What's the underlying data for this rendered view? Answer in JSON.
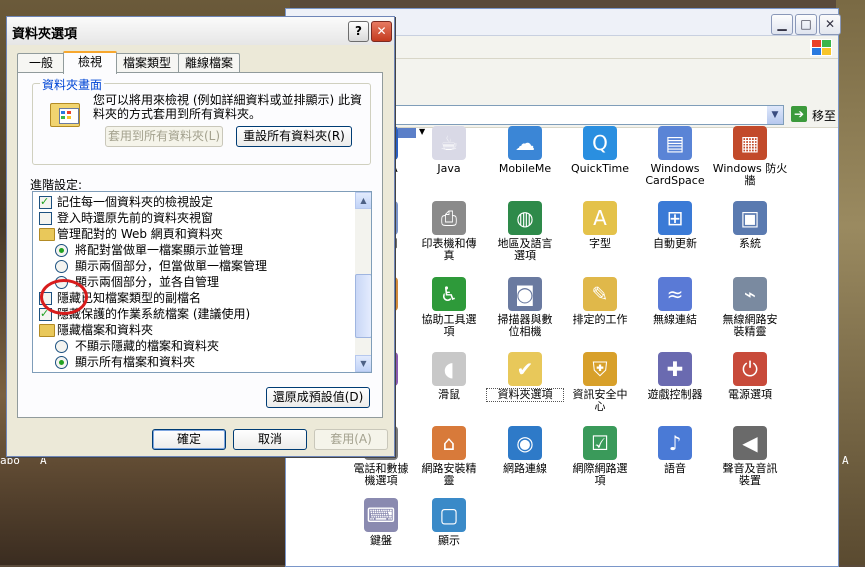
{
  "dialog": {
    "title": "資料夾選項",
    "help": "?",
    "close": "✕",
    "tabs": [
      "一般",
      "檢視",
      "檔案類型",
      "離線檔案"
    ],
    "group": {
      "label": "資料夾畫面",
      "description": "您可以將用來檢視 (例如詳細資料或並排顯示) 此資料夾的方式套用到所有資料夾。",
      "apply_all": "套用到所有資料夾(L)",
      "reset_all": "重設所有資料夾(R)"
    },
    "advanced_label": "進階設定:",
    "advanced_items": [
      {
        "kind": "checkbox",
        "checked": true,
        "text": "記住每一個資料夾的檢視設定"
      },
      {
        "kind": "checkbox",
        "checked": false,
        "text": "登入時還原先前的資料夾視窗"
      },
      {
        "kind": "folder",
        "text": "管理配對的 Web 網頁和資料夾"
      },
      {
        "kind": "radio",
        "checked": true,
        "text": "將配對當做單一檔案顯示並管理"
      },
      {
        "kind": "radio",
        "checked": false,
        "text": "顯示兩個部分，但當做單一檔案管理"
      },
      {
        "kind": "radio",
        "checked": false,
        "text": "顯示兩個部分，並各自管理"
      },
      {
        "kind": "checkbox",
        "checked": false,
        "text": "隱藏已知檔案類型的副檔名"
      },
      {
        "kind": "checkbox",
        "checked": true,
        "text": "隱藏保護的作業系統檔案 (建議使用)"
      },
      {
        "kind": "folder",
        "text": "隱藏檔案和資料夾"
      },
      {
        "kind": "radio",
        "checked": false,
        "text": "不顯示隱藏的檔案和資料夾"
      },
      {
        "kind": "radio",
        "checked": true,
        "text": "顯示所有檔案和資料夾"
      }
    ],
    "restore_defaults": "還原成預設值(D)",
    "ok": "確定",
    "cancel": "取消",
    "apply": "套用(A)"
  },
  "control_panel": {
    "go_label": "移至",
    "icons": [
      {
        "label": ") GMA\nver",
        "icon": "monitor-icon",
        "color": "#2a5fc0"
      },
      {
        "label": "Java",
        "icon": "java-cup-icon",
        "color": "#d9d9e6"
      },
      {
        "label": "MobileMe",
        "icon": "cloud-icon",
        "color": "#3b86d6"
      },
      {
        "label": "QuickTime",
        "icon": "quicktime-icon",
        "color": "#2a8fe0"
      },
      {
        "label": "Windows\nCardSpace",
        "icon": "cardspace-icon",
        "color": "#5a84d6"
      },
      {
        "label": "Windows 防火\n牆",
        "icon": "firewall-brick-icon",
        "color": "#c24a2a"
      },
      {
        "label": "日時間",
        "icon": "clock-icon",
        "color": "#7a94c8"
      },
      {
        "label": "印表機和傳\n真",
        "icon": "printer-icon",
        "color": "#8a8a8a"
      },
      {
        "label": "地區及語言\n選項",
        "icon": "globe-icon",
        "color": "#2e8a4a"
      },
      {
        "label": "字型",
        "icon": "font-folder-icon",
        "color": "#e4c24a"
      },
      {
        "label": "自動更新",
        "icon": "windows-update-icon",
        "color": "#3a7ad6"
      },
      {
        "label": "系統",
        "icon": "system-computer-icon",
        "color": "#5a7ab0"
      },
      {
        "label": "者帳戶",
        "icon": "users-icon",
        "color": "#d28a3a"
      },
      {
        "label": "協助工具選\n項",
        "icon": "accessibility-icon",
        "color": "#2e9a3a"
      },
      {
        "label": "掃描器與數\n位相機",
        "icon": "scanner-camera-icon",
        "color": "#6a7aa0"
      },
      {
        "label": "排定的工作",
        "icon": "scheduled-tasks-icon",
        "color": "#e0b84a"
      },
      {
        "label": "無線連結",
        "icon": "wireless-link-icon",
        "color": "#5a7ad6"
      },
      {
        "label": "無線網路安\n裝精靈",
        "icon": "wireless-wizard-icon",
        "color": "#7a8aa0"
      },
      {
        "label": "硬體",
        "icon": "hardware-icon",
        "color": "#8a5ab0"
      },
      {
        "label": "滑鼠",
        "icon": "mouse-icon",
        "color": "#c8c8c8"
      },
      {
        "label": "資料夾選項",
        "icon": "folder-options-icon",
        "color": "#e8c85a"
      },
      {
        "label": "資訊安全中\n心",
        "icon": "security-shield-icon",
        "color": "#d8a02a"
      },
      {
        "label": "遊戲控制器",
        "icon": "game-controller-icon",
        "color": "#6a6ab0"
      },
      {
        "label": "電源選項",
        "icon": "power-plug-icon",
        "color": "#c84a3a"
      },
      {
        "label": "電話和數據\n機選項",
        "icon": "phone-modem-icon",
        "color": "#7a7a7a"
      },
      {
        "label": "網路安裝精\n靈",
        "icon": "network-wizard-icon",
        "color": "#d87a3a"
      },
      {
        "label": "網路連線",
        "icon": "network-connections-icon",
        "color": "#2e7ac8"
      },
      {
        "label": "網際網路選\n項",
        "icon": "internet-options-icon",
        "color": "#3a9a5a"
      },
      {
        "label": "語音",
        "icon": "speech-icon",
        "color": "#4a7ad6"
      },
      {
        "label": "聲音及音訊\n裝置",
        "icon": "speaker-icon",
        "color": "#6a6a6a"
      },
      {
        "label": "鍵盤",
        "icon": "keyboard-icon",
        "color": "#8a8ab0"
      },
      {
        "label": "顯示",
        "icon": "display-icon",
        "color": "#3a8ac8"
      }
    ]
  },
  "desktop": {
    "fragments": [
      "abo",
      "A",
      "A"
    ]
  }
}
